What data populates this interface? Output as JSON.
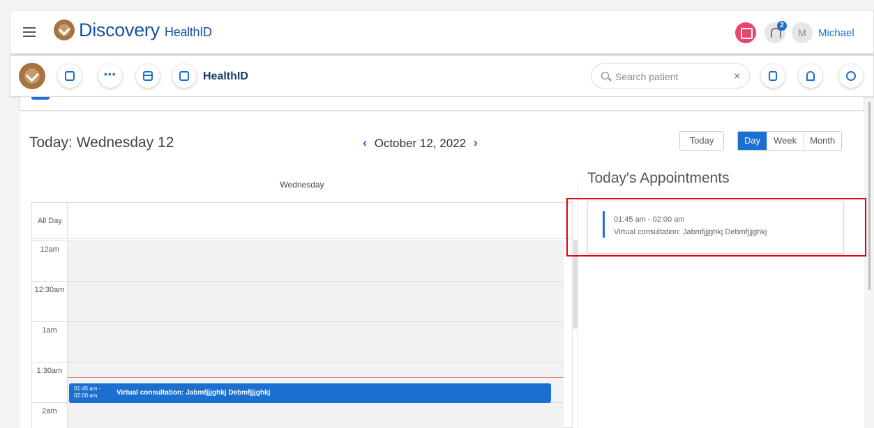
{
  "header": {
    "brand": "Discovery",
    "brand_sub": "HealthID",
    "notification_count": "2",
    "avatar_initial": "M",
    "user_name": "Michael"
  },
  "toolbar": {
    "title": "HealthID",
    "icons": [
      "calendar-icon",
      "users-icon",
      "card-icon",
      "clipboard-icon"
    ],
    "search": {
      "placeholder": "Search patient",
      "value": ""
    },
    "clear_label": "×",
    "right_icons": [
      "scan-icon",
      "bell-icon",
      "gear-icon"
    ]
  },
  "calendar": {
    "today_label": "Today: Wednesday 12",
    "prev_arrow": "‹",
    "current_date": "October 12, 2022",
    "next_arrow": "›",
    "today_button": "Today",
    "views": [
      "Day",
      "Week",
      "Month"
    ],
    "active_view": "Day",
    "day_header": "Wednesday",
    "all_day_label": "All Day",
    "time_slots": [
      "12am",
      "12:30am",
      "1am",
      "1:30am",
      "2am"
    ],
    "event": {
      "time": "01:45 am -\n02:00 am",
      "time_line1": "01:45 am -",
      "time_line2": "02:00 am",
      "title": "Virtual consultation: Jabmfjjjghkj Debmfjjjghkj"
    }
  },
  "appointments": {
    "title": "Today's Appointments",
    "items": [
      {
        "time": "01:45 am - 02:00 am",
        "description": "Virtual consultation: Jabmfjjjghkj Debmfjjjghkj"
      }
    ]
  },
  "colors": {
    "accent": "#1a6fd0",
    "brand": "#a7733f",
    "chat": "#e8456e",
    "highlight": "#e5000b"
  }
}
